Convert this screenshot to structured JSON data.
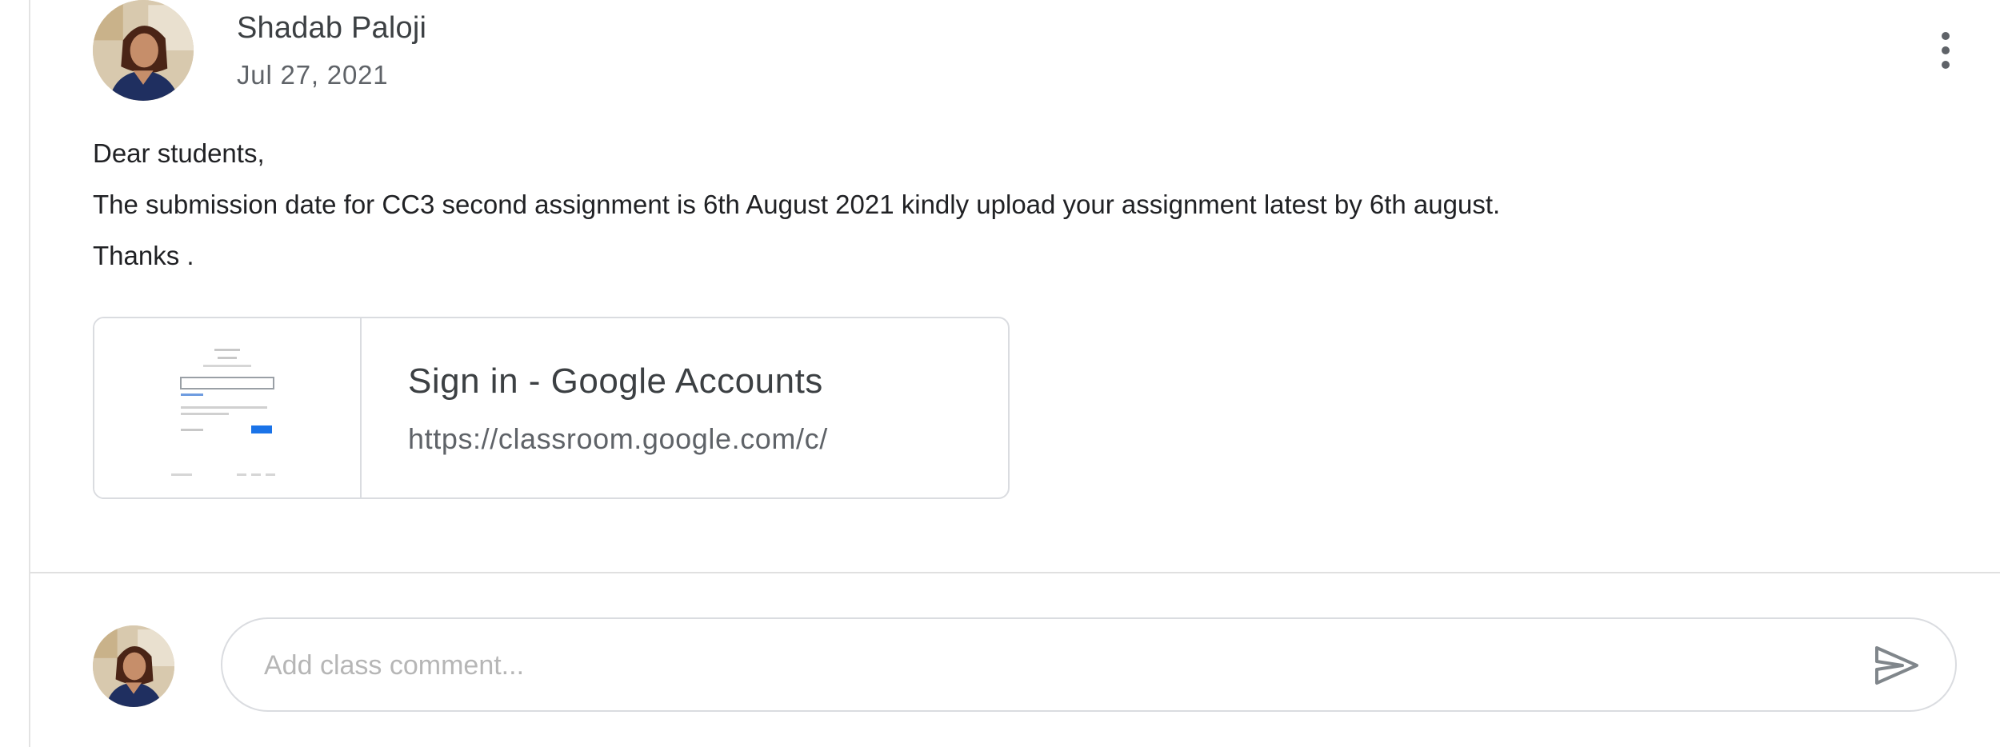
{
  "post": {
    "author_name": "Shadab Paloji",
    "date": "Jul 27, 2021",
    "author_avatar_icon": "profile-photo",
    "more_icon": "more-vert-icon",
    "body": "Dear students,\nThe submission date for CC3 second assignment is 6th August 2021 kindly upload your assignment latest by 6th august.\nThanks .",
    "attachment": {
      "title": "Sign in - Google Accounts",
      "url": "https://classroom.google.com/c/",
      "thumbnail_icon": "google-signin-page-thumbnail"
    }
  },
  "comment": {
    "avatar_icon": "profile-photo",
    "placeholder": "Add class comment...",
    "value": "",
    "send_icon": "send-icon"
  },
  "colors": {
    "border": "#dadce0",
    "text_primary": "#202124",
    "text_secondary": "#5f6368",
    "accent_blue": "#1a73e8"
  }
}
